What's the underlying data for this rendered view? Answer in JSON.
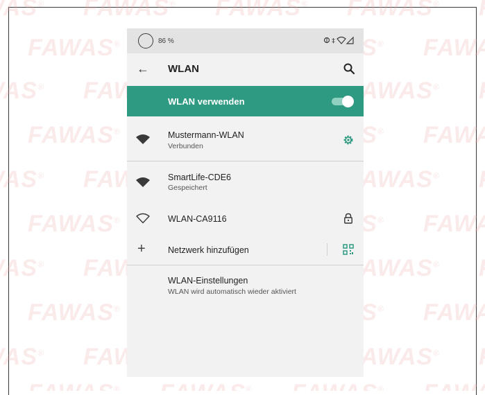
{
  "watermark": {
    "text": "FAWAS",
    "mark": "®"
  },
  "statusbar": {
    "battery": "86 %",
    "icons": "⊕ ‡ ◥"
  },
  "appbar": {
    "back_icon": "back-arrow-icon",
    "title": "WLAN",
    "search_icon": "search-icon"
  },
  "toggle": {
    "label": "WLAN verwenden",
    "state": "on",
    "accent_color": "#2e9a82"
  },
  "networks": [
    {
      "name": "Mustermann-WLAN",
      "status": "Verbunden",
      "icon": "wifi-filled-icon",
      "action_icon": "gear-icon"
    },
    {
      "name": "SmartLife-CDE6",
      "status": "Gespeichert",
      "icon": "wifi-filled-icon"
    },
    {
      "name": "WLAN-CA9116",
      "status": "",
      "icon": "wifi-outline-icon",
      "action_icon": "lock-icon"
    }
  ],
  "add_network": {
    "label": "Netzwerk hinzufügen",
    "icon": "plus-icon",
    "action_icon": "qr-code-icon"
  },
  "settings": {
    "title": "WLAN-Einstellungen",
    "subtitle": "WLAN wird automatisch wieder aktiviert"
  }
}
